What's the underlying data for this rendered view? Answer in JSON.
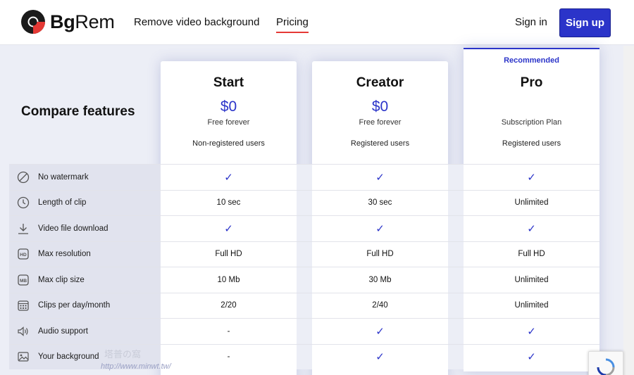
{
  "header": {
    "logo_bold": "Bg",
    "logo_rest": "Rem",
    "nav_remove": "Remove video background",
    "nav_pricing": "Pricing",
    "sign_in": "Sign in",
    "sign_up": "Sign up"
  },
  "compare_title": "Compare features",
  "plans": [
    {
      "name": "Start",
      "price": "$0",
      "note": "Free forever",
      "users": "Non-registered users"
    },
    {
      "name": "Creator",
      "price": "$0",
      "note": "Free forever",
      "users": "Registered users"
    },
    {
      "name": "Pro",
      "badge": "Recommended",
      "note": "Subscription Plan",
      "users": "Registered users"
    }
  ],
  "features": [
    {
      "icon": "no-watermark-icon",
      "label": "No watermark",
      "values": [
        "✓",
        "✓",
        "✓"
      ]
    },
    {
      "icon": "clock-icon",
      "label": "Length of clip",
      "values": [
        "10 sec",
        "30 sec",
        "Unlimited"
      ]
    },
    {
      "icon": "download-icon",
      "label": "Video file download",
      "values": [
        "✓",
        "✓",
        "✓"
      ]
    },
    {
      "icon": "hd-icon",
      "label": "Max resolution",
      "values": [
        "Full HD",
        "Full HD",
        "Full HD"
      ]
    },
    {
      "icon": "mb-icon",
      "label": "Max clip size",
      "values": [
        "10 Mb",
        "30 Mb",
        "Unlimited"
      ]
    },
    {
      "icon": "calendar-icon",
      "label": "Clips per day/month",
      "values": [
        "2/20",
        "2/40",
        "Unlimited"
      ]
    },
    {
      "icon": "speaker-icon",
      "label": "Audio support",
      "values": [
        "-",
        "✓",
        "✓"
      ]
    },
    {
      "icon": "image-icon",
      "label": "Your background",
      "values": [
        "-",
        "✓",
        "✓"
      ]
    }
  ],
  "watermark": {
    "line1": "塔普の窩",
    "line2": "http://www.minwt.tw/"
  },
  "colors": {
    "accent": "#2b34c9",
    "nav_underline": "#e53935",
    "label_bg": "#e1e3ee"
  }
}
